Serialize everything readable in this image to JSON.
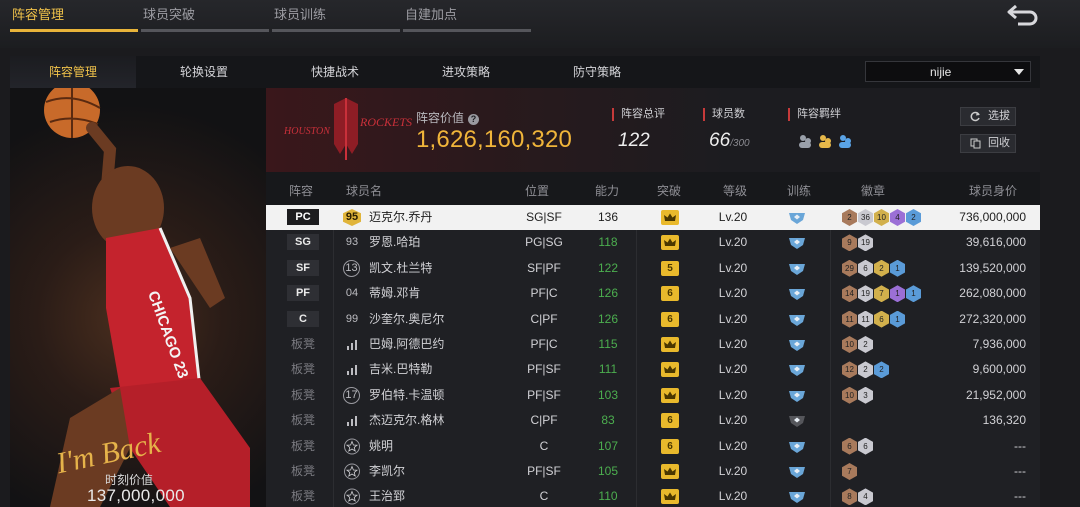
{
  "top_tabs": [
    {
      "label": "阵容管理",
      "active": true
    },
    {
      "label": "球员突破",
      "active": false
    },
    {
      "label": "球员训练",
      "active": false
    },
    {
      "label": "自建加点",
      "active": false
    }
  ],
  "sub_tabs": [
    {
      "label": "阵容管理",
      "active": true
    },
    {
      "label": "轮换设置",
      "active": false
    },
    {
      "label": "快捷战术",
      "active": false
    },
    {
      "label": "进攻策略",
      "active": false
    },
    {
      "label": "防守策略",
      "active": false
    }
  ],
  "lineup_select": {
    "value": "nijie"
  },
  "player_card": {
    "signature": "I'm Back",
    "jersey_text": "CHICAGO 23",
    "value_label": "时刻价值",
    "value": "137,000,000"
  },
  "team": {
    "logo_text_left": "HOUSTON",
    "logo_text_right": "ROCKETS",
    "value_label": "阵容价值",
    "value": "1,626,160,320",
    "stats": [
      {
        "label": "阵容总评",
        "value": "122",
        "suffix": ""
      },
      {
        "label": "球员数",
        "value": "66",
        "suffix": "/300"
      },
      {
        "label": "阵容羁绊",
        "value": "",
        "suffix": ""
      }
    ],
    "buttons": {
      "select": "选拔",
      "recycle": "回收"
    }
  },
  "table": {
    "headers": [
      "阵容",
      "球员名",
      "位置",
      "能力",
      "突破",
      "等级",
      "训练",
      "徽章",
      "球员身价"
    ],
    "rows": [
      {
        "slot": "PC",
        "bench": false,
        "num": "95",
        "num_style": "gold",
        "name": "迈克尔.乔丹",
        "pos": "SG|SF",
        "ability": "136",
        "green": false,
        "breakthrough": "",
        "level": "Lv.20",
        "train": true,
        "badges": [
          {
            "v": "2",
            "c": "#a87a5c"
          },
          {
            "v": "36",
            "c": "#c9c9d0"
          },
          {
            "v": "10",
            "c": "#d2b04c"
          },
          {
            "v": "4",
            "c": "#9b6fd6"
          },
          {
            "v": "2",
            "c": "#5a9bd8"
          }
        ],
        "worth": "736,000,000",
        "selected": true
      },
      {
        "slot": "SG",
        "bench": false,
        "num": "93",
        "num_style": "plain",
        "name": "罗恩.哈珀",
        "pos": "PG|SG",
        "ability": "118",
        "green": true,
        "breakthrough": "",
        "level": "Lv.20",
        "train": true,
        "badges": [
          {
            "v": "9",
            "c": "#a87a5c"
          },
          {
            "v": "19",
            "c": "#c9c9d0"
          }
        ],
        "worth": "39,616,000",
        "selected": false
      },
      {
        "slot": "SF",
        "bench": false,
        "num": "13",
        "num_style": "circle",
        "name": "凯文.杜兰特",
        "pos": "SF|PF",
        "ability": "122",
        "green": true,
        "breakthrough": "5",
        "level": "Lv.20",
        "train": true,
        "badges": [
          {
            "v": "29",
            "c": "#a87a5c"
          },
          {
            "v": "6",
            "c": "#c9c9d0"
          },
          {
            "v": "2",
            "c": "#d2b04c"
          },
          {
            "v": "1",
            "c": "#5a9bd8"
          }
        ],
        "worth": "139,520,000",
        "selected": false
      },
      {
        "slot": "PF",
        "bench": false,
        "num": "04",
        "num_style": "plain",
        "name": "蒂姆.邓肯",
        "pos": "PF|C",
        "ability": "126",
        "green": true,
        "breakthrough": "6",
        "level": "Lv.20",
        "train": true,
        "badges": [
          {
            "v": "14",
            "c": "#a87a5c"
          },
          {
            "v": "19",
            "c": "#c9c9d0"
          },
          {
            "v": "7",
            "c": "#d2b04c"
          },
          {
            "v": "1",
            "c": "#9b6fd6"
          },
          {
            "v": "1",
            "c": "#5a9bd8"
          }
        ],
        "worth": "262,080,000",
        "selected": false
      },
      {
        "slot": "C",
        "bench": false,
        "num": "99",
        "num_style": "plain",
        "name": "沙奎尔.奥尼尔",
        "pos": "C|PF",
        "ability": "126",
        "green": true,
        "breakthrough": "6",
        "level": "Lv.20",
        "train": true,
        "badges": [
          {
            "v": "11",
            "c": "#a87a5c"
          },
          {
            "v": "11",
            "c": "#c9c9d0"
          },
          {
            "v": "6",
            "c": "#d2b04c"
          },
          {
            "v": "1",
            "c": "#5a9bd8"
          }
        ],
        "worth": "272,320,000",
        "selected": false
      },
      {
        "slot": "板凳",
        "bench": true,
        "num": "",
        "num_style": "bars",
        "name": "巴姆.阿德巴约",
        "pos": "PF|C",
        "ability": "115",
        "green": true,
        "breakthrough": "",
        "level": "Lv.20",
        "train": true,
        "badges": [
          {
            "v": "10",
            "c": "#a87a5c"
          },
          {
            "v": "2",
            "c": "#c9c9d0"
          }
        ],
        "worth": "7,936,000",
        "selected": false
      },
      {
        "slot": "板凳",
        "bench": true,
        "num": "",
        "num_style": "bars",
        "name": "吉米.巴特勒",
        "pos": "PF|SF",
        "ability": "111",
        "green": true,
        "breakthrough": "",
        "level": "Lv.20",
        "train": true,
        "badges": [
          {
            "v": "12",
            "c": "#a87a5c"
          },
          {
            "v": "2",
            "c": "#c9c9d0"
          },
          {
            "v": "2",
            "c": "#5a9bd8"
          }
        ],
        "worth": "9,600,000",
        "selected": false
      },
      {
        "slot": "板凳",
        "bench": true,
        "num": "17",
        "num_style": "circle",
        "name": "罗伯特.卡温顿",
        "pos": "PF|SF",
        "ability": "103",
        "green": true,
        "breakthrough": "",
        "level": "Lv.20",
        "train": true,
        "badges": [
          {
            "v": "10",
            "c": "#a87a5c"
          },
          {
            "v": "3",
            "c": "#c9c9d0"
          }
        ],
        "worth": "21,952,000",
        "selected": false
      },
      {
        "slot": "板凳",
        "bench": true,
        "num": "",
        "num_style": "bars",
        "name": "杰迈克尔.格林",
        "pos": "C|PF",
        "ability": "83",
        "green": true,
        "breakthrough": "6",
        "level": "Lv.20",
        "train": false,
        "badges": [],
        "worth": "136,320",
        "selected": false
      },
      {
        "slot": "板凳",
        "bench": true,
        "num": "",
        "num_style": "star",
        "name": "姚明",
        "pos": "C",
        "ability": "107",
        "green": true,
        "breakthrough": "6",
        "level": "Lv.20",
        "train": true,
        "badges": [
          {
            "v": "6",
            "c": "#a87a5c"
          },
          {
            "v": "6",
            "c": "#c9c9d0"
          }
        ],
        "worth": "---",
        "selected": false
      },
      {
        "slot": "板凳",
        "bench": true,
        "num": "",
        "num_style": "star",
        "name": "李凯尔",
        "pos": "PF|SF",
        "ability": "105",
        "green": true,
        "breakthrough": "",
        "level": "Lv.20",
        "train": true,
        "badges": [
          {
            "v": "7",
            "c": "#a87a5c"
          }
        ],
        "worth": "---",
        "selected": false
      },
      {
        "slot": "板凳",
        "bench": true,
        "num": "",
        "num_style": "star",
        "name": "王治郅",
        "pos": "C",
        "ability": "110",
        "green": true,
        "breakthrough": "",
        "level": "Lv.20",
        "train": true,
        "badges": [
          {
            "v": "8",
            "c": "#a87a5c"
          },
          {
            "v": "4",
            "c": "#c9c9d0"
          }
        ],
        "worth": "---",
        "selected": false
      }
    ]
  },
  "colors": {
    "accent": "#f0c24a",
    "value_orange": "#f0b53a",
    "ability_green": "#4cae4f",
    "team_red": "#c63a3a"
  }
}
